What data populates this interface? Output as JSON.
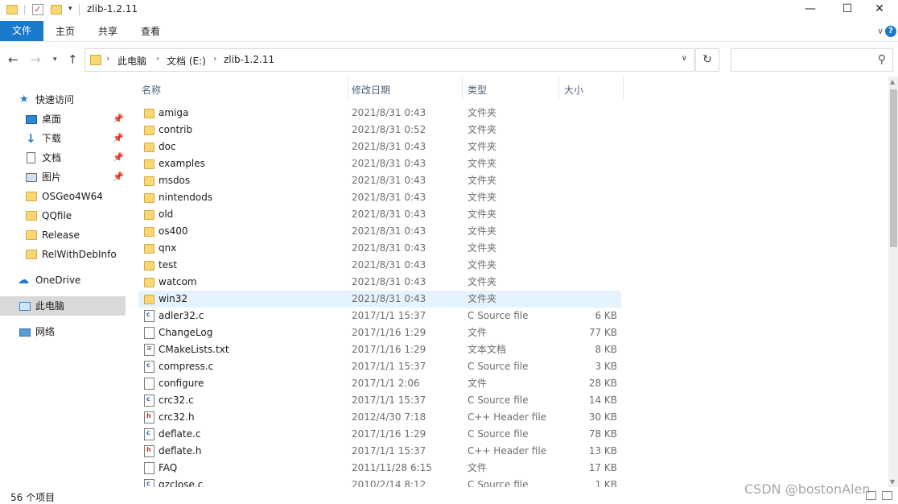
{
  "window": {
    "title": "zlib-1.2.11",
    "minimize": "—",
    "maximize": "☐",
    "close": "✕"
  },
  "ribbon": {
    "tabs": [
      "文件",
      "主页",
      "共享",
      "查看"
    ]
  },
  "address": {
    "crumbs": [
      "此电脑",
      "文档 (E:)",
      "zlib-1.2.11"
    ]
  },
  "search": {
    "placeholder": ""
  },
  "nav": {
    "items": [
      {
        "label": "快速访问",
        "icon": "star-icon"
      },
      {
        "label": "桌面",
        "icon": "desktop-icon",
        "pinned": true
      },
      {
        "label": "下载",
        "icon": "download-icon",
        "pinned": true
      },
      {
        "label": "文档",
        "icon": "document-icon",
        "pinned": true
      },
      {
        "label": "图片",
        "icon": "picture-icon",
        "pinned": true
      },
      {
        "label": "OSGeo4W64",
        "icon": "folder-icon"
      },
      {
        "label": "QQfile",
        "icon": "folder-icon"
      },
      {
        "label": "Release",
        "icon": "folder-icon"
      },
      {
        "label": "RelWithDebInfo",
        "icon": "folder-icon"
      },
      {
        "label": "OneDrive",
        "icon": "cloud-icon"
      },
      {
        "label": "此电脑",
        "icon": "computer-icon",
        "selected": true
      },
      {
        "label": "网络",
        "icon": "network-icon"
      }
    ]
  },
  "columns": {
    "name": "名称",
    "date": "修改日期",
    "type": "类型",
    "size": "大小"
  },
  "files": [
    {
      "name": "amiga",
      "date": "2021/8/31 0:43",
      "type": "文件夹",
      "size": "",
      "icon": "folder"
    },
    {
      "name": "contrib",
      "date": "2021/8/31 0:52",
      "type": "文件夹",
      "size": "",
      "icon": "folder"
    },
    {
      "name": "doc",
      "date": "2021/8/31 0:43",
      "type": "文件夹",
      "size": "",
      "icon": "folder"
    },
    {
      "name": "examples",
      "date": "2021/8/31 0:43",
      "type": "文件夹",
      "size": "",
      "icon": "folder"
    },
    {
      "name": "msdos",
      "date": "2021/8/31 0:43",
      "type": "文件夹",
      "size": "",
      "icon": "folder"
    },
    {
      "name": "nintendods",
      "date": "2021/8/31 0:43",
      "type": "文件夹",
      "size": "",
      "icon": "folder"
    },
    {
      "name": "old",
      "date": "2021/8/31 0:43",
      "type": "文件夹",
      "size": "",
      "icon": "folder"
    },
    {
      "name": "os400",
      "date": "2021/8/31 0:43",
      "type": "文件夹",
      "size": "",
      "icon": "folder"
    },
    {
      "name": "qnx",
      "date": "2021/8/31 0:43",
      "type": "文件夹",
      "size": "",
      "icon": "folder"
    },
    {
      "name": "test",
      "date": "2021/8/31 0:43",
      "type": "文件夹",
      "size": "",
      "icon": "folder"
    },
    {
      "name": "watcom",
      "date": "2021/8/31 0:43",
      "type": "文件夹",
      "size": "",
      "icon": "folder"
    },
    {
      "name": "win32",
      "date": "2021/8/31 0:43",
      "type": "文件夹",
      "size": "",
      "icon": "folder",
      "hover": true
    },
    {
      "name": "adler32.c",
      "date": "2017/1/1 15:37",
      "type": "C Source file",
      "size": "6 KB",
      "icon": "c"
    },
    {
      "name": "ChangeLog",
      "date": "2017/1/16 1:29",
      "type": "文件",
      "size": "77 KB",
      "icon": "blank"
    },
    {
      "name": "CMakeLists.txt",
      "date": "2017/1/16 1:29",
      "type": "文本文档",
      "size": "8 KB",
      "icon": "txt"
    },
    {
      "name": "compress.c",
      "date": "2017/1/1 15:37",
      "type": "C Source file",
      "size": "3 KB",
      "icon": "c"
    },
    {
      "name": "configure",
      "date": "2017/1/1 2:06",
      "type": "文件",
      "size": "28 KB",
      "icon": "blank"
    },
    {
      "name": "crc32.c",
      "date": "2017/1/1 15:37",
      "type": "C Source file",
      "size": "14 KB",
      "icon": "c"
    },
    {
      "name": "crc32.h",
      "date": "2012/4/30 7:18",
      "type": "C++ Header file",
      "size": "30 KB",
      "icon": "h"
    },
    {
      "name": "deflate.c",
      "date": "2017/1/16 1:29",
      "type": "C Source file",
      "size": "78 KB",
      "icon": "c"
    },
    {
      "name": "deflate.h",
      "date": "2017/1/1 15:37",
      "type": "C++ Header file",
      "size": "13 KB",
      "icon": "h"
    },
    {
      "name": "FAQ",
      "date": "2011/11/28 6:15",
      "type": "文件",
      "size": "17 KB",
      "icon": "blank"
    },
    {
      "name": "gzclose.c",
      "date": "2010/2/14 8:12",
      "type": "C Source file",
      "size": "1 KB",
      "icon": "c"
    }
  ],
  "status": {
    "count": "56 个项目"
  },
  "watermark": "CSDN @bostonAlen"
}
